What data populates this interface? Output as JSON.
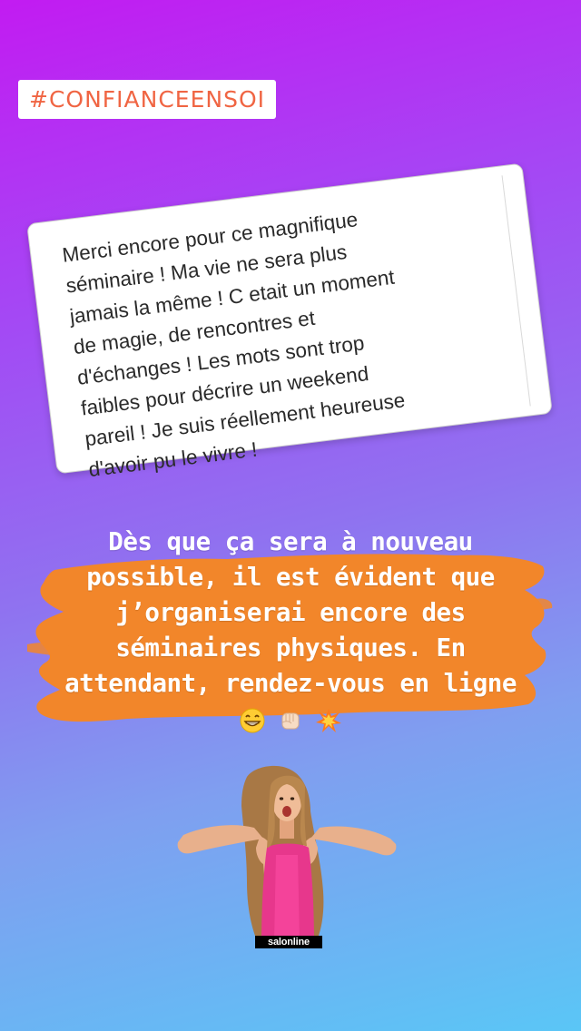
{
  "hashtag": "#CONFIANCEENSOI",
  "testimonial": {
    "text": "Merci encore pour ce magnifique séminaire ! Ma vie ne sera plus jamais la même ! C etait un moment de magie, de rencontres et d'échanges ! Les mots sont trop faibles pour décrire un weekend pareil ! Je suis réellement heureuse d'avoir pu le vivre !",
    "lines": [
      "Merci encore pour ce magnifique",
      "séminaire ! Ma vie ne sera plus",
      "jamais la même ! C etait un moment",
      "de magie, de rencontres et",
      "d'échanges ! Les mots sont trop",
      "faibles pour décrire un weekend",
      "pareil ! Je suis réellement heureuse",
      "d'avoir pu le vivre !"
    ]
  },
  "caption": {
    "lines": [
      "Dès que ça sera à nouveau",
      "possible, il est évident que",
      "j’organiserai encore des",
      "séminaires physiques. En",
      "attendant, rendez-vous en ligne"
    ],
    "emojis": [
      "grinning-face",
      "fist-bump",
      "collision"
    ]
  },
  "gif_sticker": {
    "label": "salonline",
    "subject": "woman pointing down"
  },
  "colors": {
    "gradient_top": "#c21bf2",
    "gradient_bottom": "#5ac6f6",
    "brush": "#f2862a",
    "hashtag_text": "#f06543"
  }
}
